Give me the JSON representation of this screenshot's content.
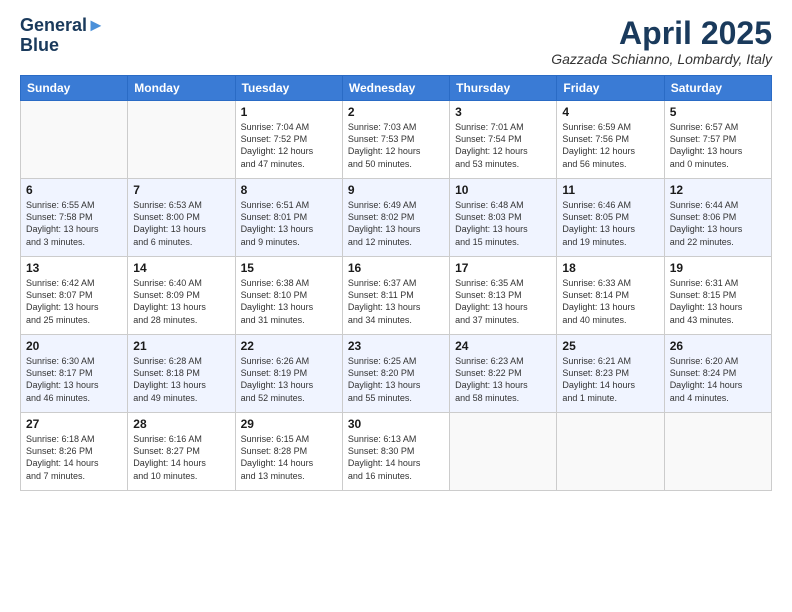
{
  "header": {
    "logo_line1": "General",
    "logo_line2": "Blue",
    "month": "April 2025",
    "location": "Gazzada Schianno, Lombardy, Italy"
  },
  "days_of_week": [
    "Sunday",
    "Monday",
    "Tuesday",
    "Wednesday",
    "Thursday",
    "Friday",
    "Saturday"
  ],
  "weeks": [
    [
      {
        "day": "",
        "info": ""
      },
      {
        "day": "",
        "info": ""
      },
      {
        "day": "1",
        "info": "Sunrise: 7:04 AM\nSunset: 7:52 PM\nDaylight: 12 hours\nand 47 minutes."
      },
      {
        "day": "2",
        "info": "Sunrise: 7:03 AM\nSunset: 7:53 PM\nDaylight: 12 hours\nand 50 minutes."
      },
      {
        "day": "3",
        "info": "Sunrise: 7:01 AM\nSunset: 7:54 PM\nDaylight: 12 hours\nand 53 minutes."
      },
      {
        "day": "4",
        "info": "Sunrise: 6:59 AM\nSunset: 7:56 PM\nDaylight: 12 hours\nand 56 minutes."
      },
      {
        "day": "5",
        "info": "Sunrise: 6:57 AM\nSunset: 7:57 PM\nDaylight: 13 hours\nand 0 minutes."
      }
    ],
    [
      {
        "day": "6",
        "info": "Sunrise: 6:55 AM\nSunset: 7:58 PM\nDaylight: 13 hours\nand 3 minutes."
      },
      {
        "day": "7",
        "info": "Sunrise: 6:53 AM\nSunset: 8:00 PM\nDaylight: 13 hours\nand 6 minutes."
      },
      {
        "day": "8",
        "info": "Sunrise: 6:51 AM\nSunset: 8:01 PM\nDaylight: 13 hours\nand 9 minutes."
      },
      {
        "day": "9",
        "info": "Sunrise: 6:49 AM\nSunset: 8:02 PM\nDaylight: 13 hours\nand 12 minutes."
      },
      {
        "day": "10",
        "info": "Sunrise: 6:48 AM\nSunset: 8:03 PM\nDaylight: 13 hours\nand 15 minutes."
      },
      {
        "day": "11",
        "info": "Sunrise: 6:46 AM\nSunset: 8:05 PM\nDaylight: 13 hours\nand 19 minutes."
      },
      {
        "day": "12",
        "info": "Sunrise: 6:44 AM\nSunset: 8:06 PM\nDaylight: 13 hours\nand 22 minutes."
      }
    ],
    [
      {
        "day": "13",
        "info": "Sunrise: 6:42 AM\nSunset: 8:07 PM\nDaylight: 13 hours\nand 25 minutes."
      },
      {
        "day": "14",
        "info": "Sunrise: 6:40 AM\nSunset: 8:09 PM\nDaylight: 13 hours\nand 28 minutes."
      },
      {
        "day": "15",
        "info": "Sunrise: 6:38 AM\nSunset: 8:10 PM\nDaylight: 13 hours\nand 31 minutes."
      },
      {
        "day": "16",
        "info": "Sunrise: 6:37 AM\nSunset: 8:11 PM\nDaylight: 13 hours\nand 34 minutes."
      },
      {
        "day": "17",
        "info": "Sunrise: 6:35 AM\nSunset: 8:13 PM\nDaylight: 13 hours\nand 37 minutes."
      },
      {
        "day": "18",
        "info": "Sunrise: 6:33 AM\nSunset: 8:14 PM\nDaylight: 13 hours\nand 40 minutes."
      },
      {
        "day": "19",
        "info": "Sunrise: 6:31 AM\nSunset: 8:15 PM\nDaylight: 13 hours\nand 43 minutes."
      }
    ],
    [
      {
        "day": "20",
        "info": "Sunrise: 6:30 AM\nSunset: 8:17 PM\nDaylight: 13 hours\nand 46 minutes."
      },
      {
        "day": "21",
        "info": "Sunrise: 6:28 AM\nSunset: 8:18 PM\nDaylight: 13 hours\nand 49 minutes."
      },
      {
        "day": "22",
        "info": "Sunrise: 6:26 AM\nSunset: 8:19 PM\nDaylight: 13 hours\nand 52 minutes."
      },
      {
        "day": "23",
        "info": "Sunrise: 6:25 AM\nSunset: 8:20 PM\nDaylight: 13 hours\nand 55 minutes."
      },
      {
        "day": "24",
        "info": "Sunrise: 6:23 AM\nSunset: 8:22 PM\nDaylight: 13 hours\nand 58 minutes."
      },
      {
        "day": "25",
        "info": "Sunrise: 6:21 AM\nSunset: 8:23 PM\nDaylight: 14 hours\nand 1 minute."
      },
      {
        "day": "26",
        "info": "Sunrise: 6:20 AM\nSunset: 8:24 PM\nDaylight: 14 hours\nand 4 minutes."
      }
    ],
    [
      {
        "day": "27",
        "info": "Sunrise: 6:18 AM\nSunset: 8:26 PM\nDaylight: 14 hours\nand 7 minutes."
      },
      {
        "day": "28",
        "info": "Sunrise: 6:16 AM\nSunset: 8:27 PM\nDaylight: 14 hours\nand 10 minutes."
      },
      {
        "day": "29",
        "info": "Sunrise: 6:15 AM\nSunset: 8:28 PM\nDaylight: 14 hours\nand 13 minutes."
      },
      {
        "day": "30",
        "info": "Sunrise: 6:13 AM\nSunset: 8:30 PM\nDaylight: 14 hours\nand 16 minutes."
      },
      {
        "day": "",
        "info": ""
      },
      {
        "day": "",
        "info": ""
      },
      {
        "day": "",
        "info": ""
      }
    ]
  ]
}
